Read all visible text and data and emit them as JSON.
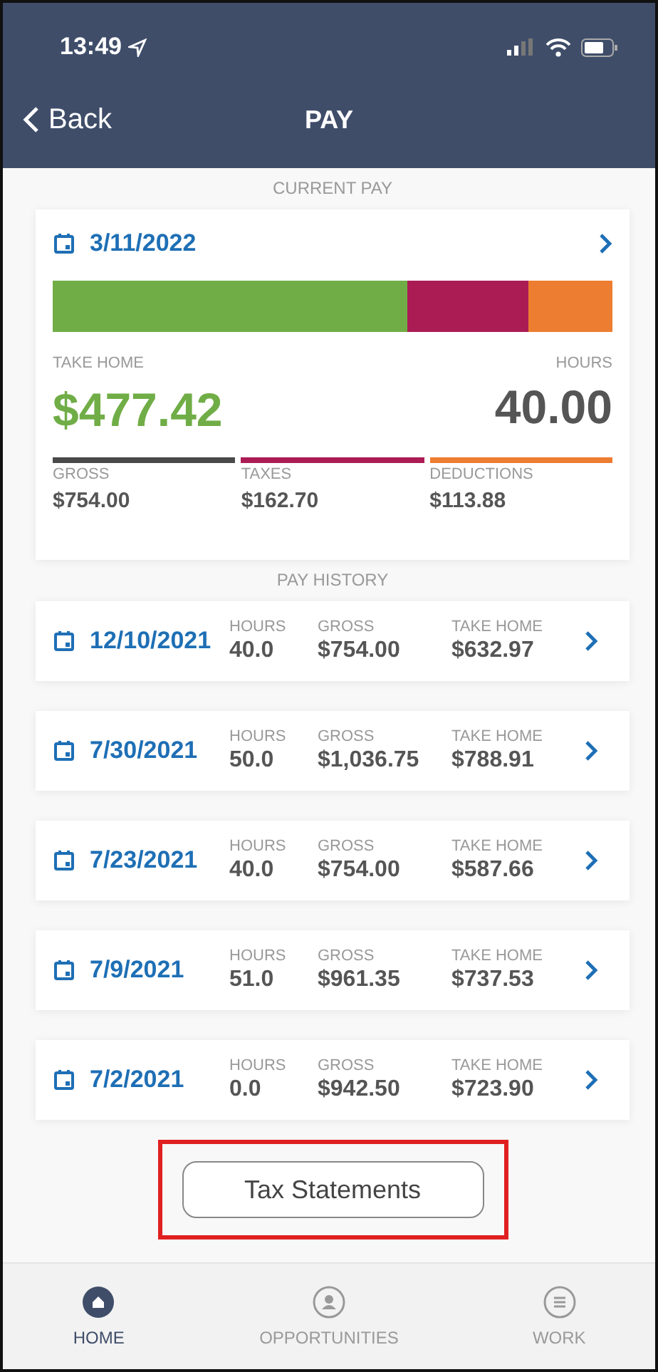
{
  "status_bar": {
    "time": "13:49"
  },
  "nav": {
    "back": "Back",
    "title": "PAY"
  },
  "current_pay": {
    "heading": "CURRENT PAY",
    "date": "3/11/2022",
    "bar": [
      {
        "color": "#70ad47"
      },
      {
        "color": "#ab1c55"
      },
      {
        "color": "#ed7d31"
      }
    ],
    "take_home_label": "TAKE HOME",
    "take_home": "$477.42",
    "hours_label": "HOURS",
    "hours": "40.00",
    "breakdown": [
      {
        "label": "GROSS",
        "value": "$754.00",
        "color": "#4a4a4a"
      },
      {
        "label": "TAXES",
        "value": "$162.70",
        "color": "#ab1c55"
      },
      {
        "label": "DEDUCTIONS",
        "value": "$113.88",
        "color": "#ed7d31"
      }
    ]
  },
  "pay_history": {
    "heading": "PAY HISTORY",
    "rows": [
      {
        "date": "12/10/2021",
        "hours_label": "HOURS",
        "hours": "40.0",
        "gross_label": "GROSS",
        "gross": "$754.00",
        "take_home_label": "TAKE HOME",
        "take_home": "$632.97"
      },
      {
        "date": "7/30/2021",
        "hours_label": "HOURS",
        "hours": "50.0",
        "gross_label": "GROSS",
        "gross": "$1,036.75",
        "take_home_label": "TAKE HOME",
        "take_home": "$788.91"
      },
      {
        "date": "7/23/2021",
        "hours_label": "HOURS",
        "hours": "40.0",
        "gross_label": "GROSS",
        "gross": "$754.00",
        "take_home_label": "TAKE HOME",
        "take_home": "$587.66"
      },
      {
        "date": "7/9/2021",
        "hours_label": "HOURS",
        "hours": "51.0",
        "gross_label": "GROSS",
        "gross": "$961.35",
        "take_home_label": "TAKE HOME",
        "take_home": "$737.53"
      },
      {
        "date": "7/2/2021",
        "hours_label": "HOURS",
        "hours": "0.0",
        "gross_label": "GROSS",
        "gross": "$942.50",
        "take_home_label": "TAKE HOME",
        "take_home": "$723.90"
      }
    ]
  },
  "tax_statements_button": {
    "label": "Tax Statements",
    "highlighted": true
  },
  "tab_bar": [
    {
      "label": "HOME",
      "kind": "home",
      "selected": true
    },
    {
      "label": "OPPORTUNITIES",
      "kind": "person",
      "selected": false
    },
    {
      "label": "WORK",
      "kind": "list",
      "selected": false
    }
  ]
}
